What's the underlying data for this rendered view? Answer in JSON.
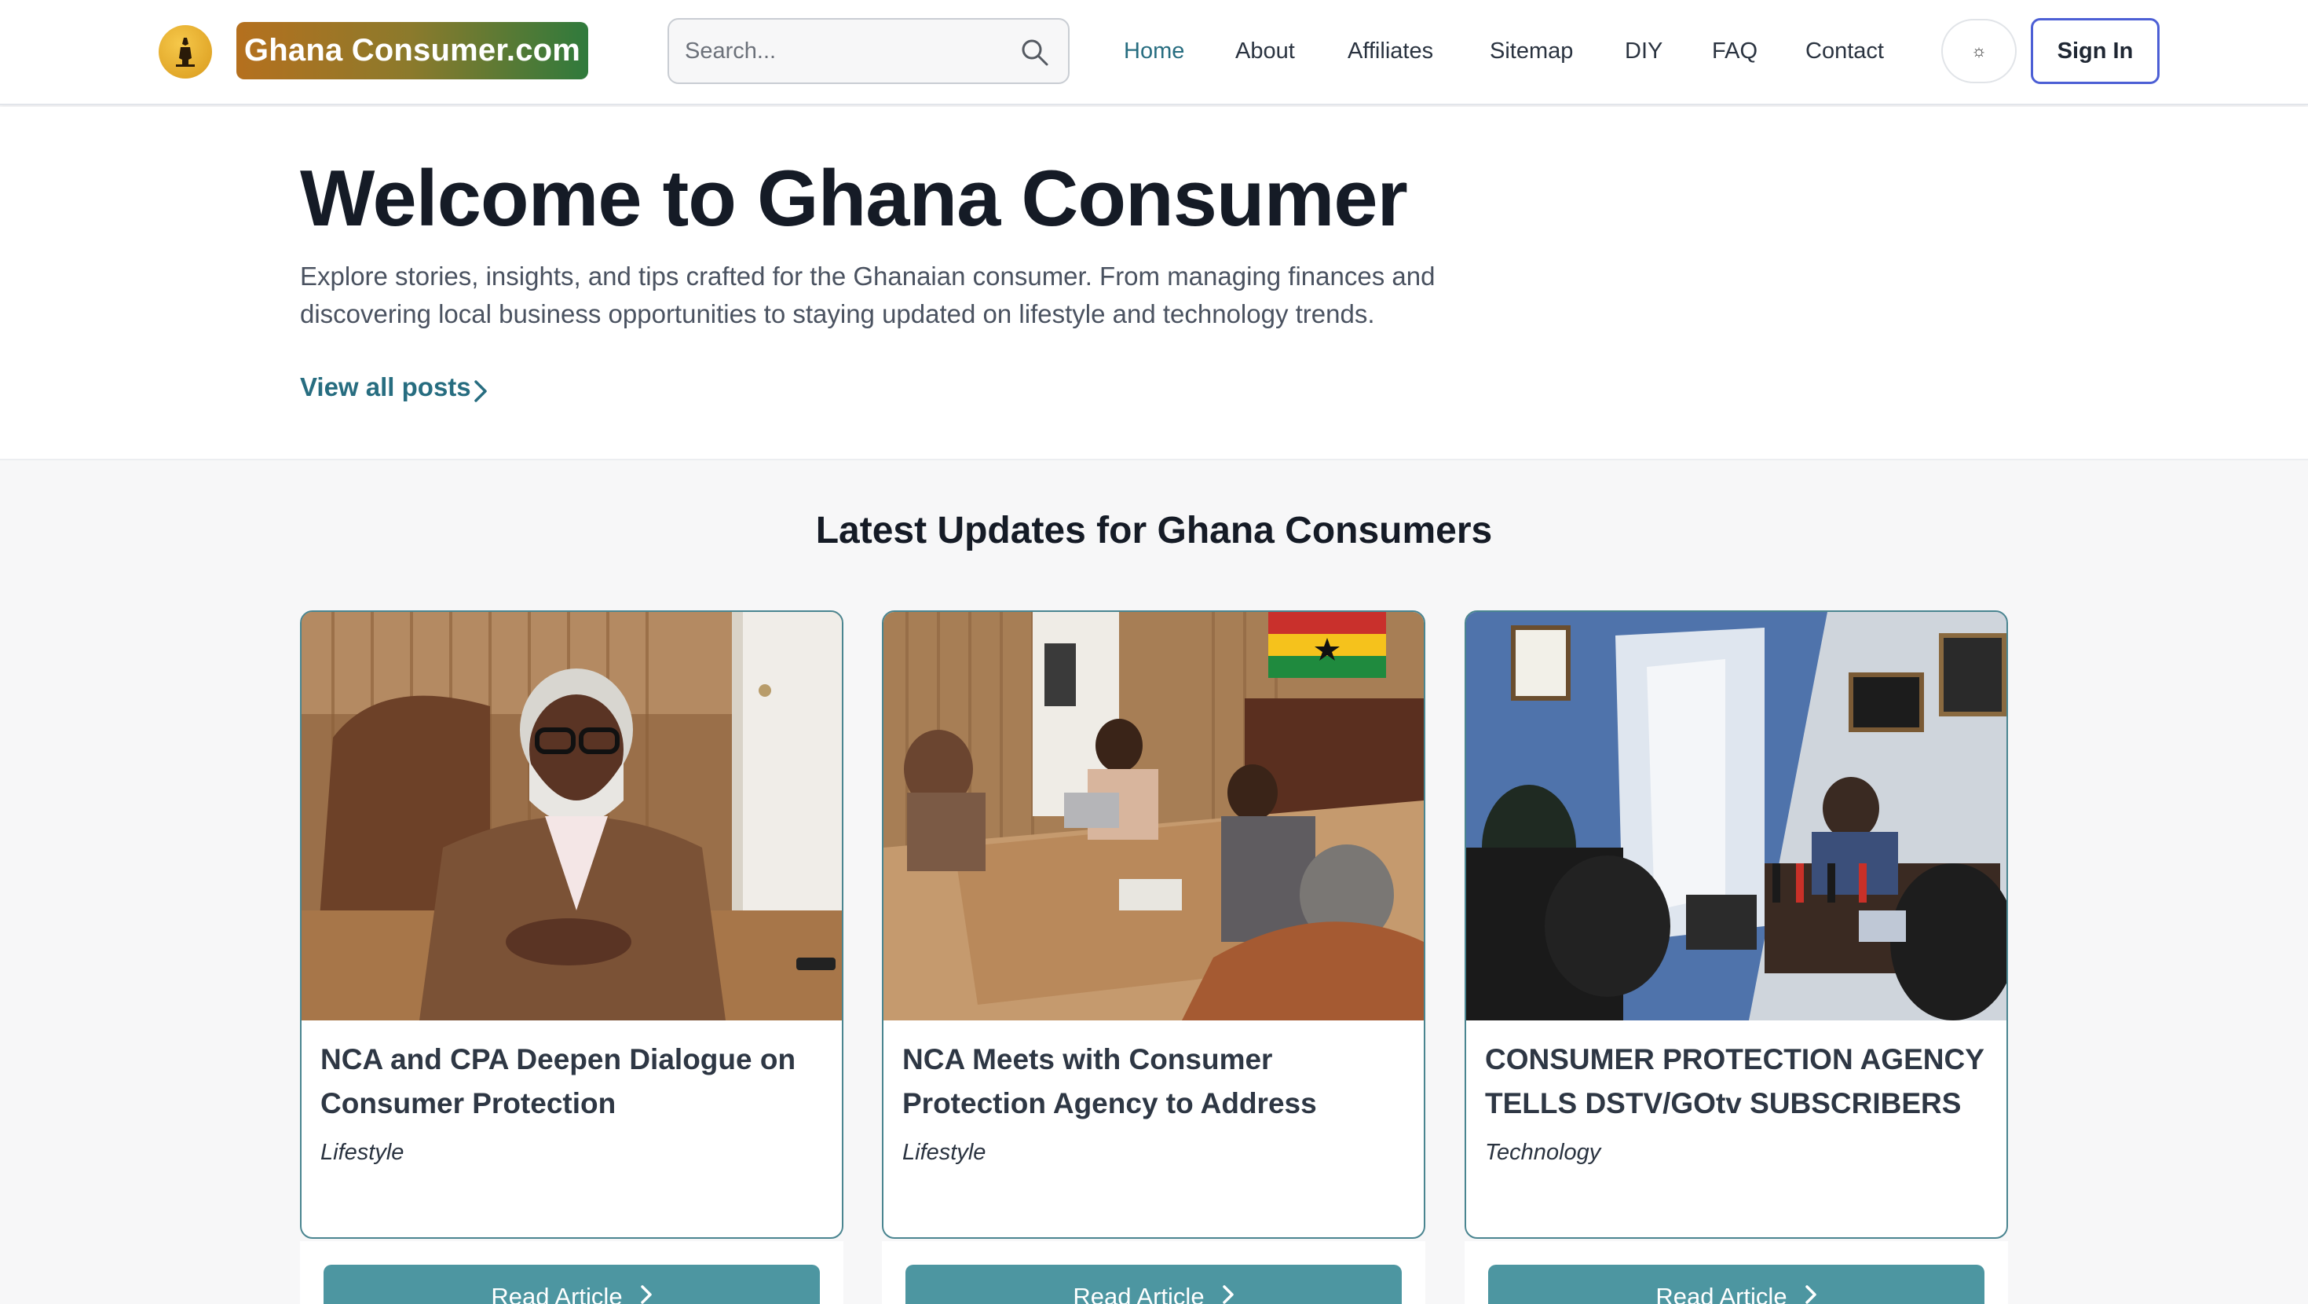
{
  "nav": {
    "brand": "Ghana Consumer.com",
    "logo_icon": "pharaoh-figure-logo",
    "search_placeholder": "Search...",
    "menu": [
      {
        "label": "Home",
        "active": true
      },
      {
        "label": "About",
        "active": false
      },
      {
        "label": "Affiliates",
        "active": false
      },
      {
        "label": "Sitemap",
        "active": false
      },
      {
        "label": "DIY",
        "active": false
      },
      {
        "label": "FAQ",
        "active": false
      },
      {
        "label": "Contact",
        "active": false
      }
    ],
    "theme_toggle_icon": "☼",
    "sign_in": "Sign In"
  },
  "hero": {
    "title": "Welcome to Ghana Consumer",
    "lead": "Explore stories, insights, and tips crafted for the Ghanaian consumer. From managing finances and discovering local business opportunities to staying updated on lifestyle and technology trends.",
    "link": "View all posts"
  },
  "latest": {
    "title": "Latest Updates for Ghana Consumers",
    "cards": [
      {
        "title": "NCA and CPA Deepen Dialogue on Consumer Protection",
        "category": "Lifestyle",
        "button": "Read Article"
      },
      {
        "title": "NCA Meets with Consumer Protection Agency to Address Industry Concerns",
        "category": "Lifestyle",
        "button": "Read Article"
      },
      {
        "title": "CONSUMER PROTECTION AGENCY TELLS DSTV/GOtv SUBSCRIBERS T...",
        "category": "Technology",
        "button": "Read Article"
      }
    ]
  },
  "colors": {
    "accent": "#276d80",
    "button": "#4d96a1",
    "sign_in_border": "#4c5fd5"
  }
}
